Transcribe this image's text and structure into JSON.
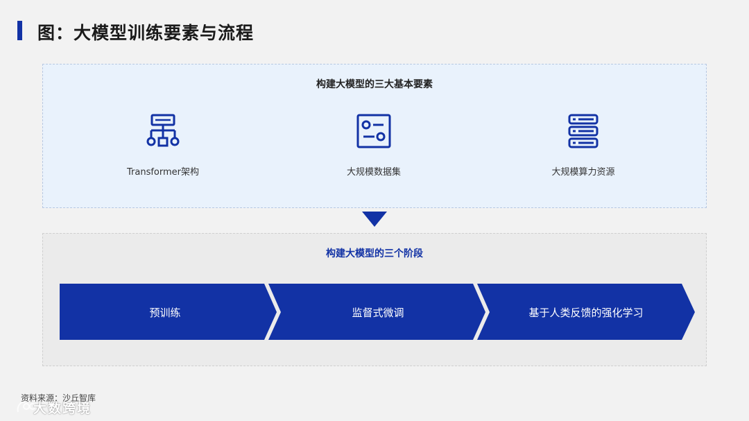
{
  "page": {
    "title": "图：大模型训练要素与流程",
    "accent_color": "#1232a5"
  },
  "elements_section": {
    "heading": "构建大模型的三大基本要素",
    "items": [
      {
        "label": "Transformer架构",
        "icon": "network-hierarchy-icon"
      },
      {
        "label": "大规模数据集",
        "icon": "dataset-panel-icon"
      },
      {
        "label": "大规模算力资源",
        "icon": "server-stack-icon"
      }
    ]
  },
  "stages_section": {
    "heading": "构建大模型的三个阶段",
    "stages": [
      {
        "label": "预训练"
      },
      {
        "label": "监督式微调"
      },
      {
        "label": "基于人类反馈的强化学习"
      }
    ]
  },
  "footer": {
    "source": "资料来源：沙丘智库",
    "watermark": "大数跨境"
  }
}
